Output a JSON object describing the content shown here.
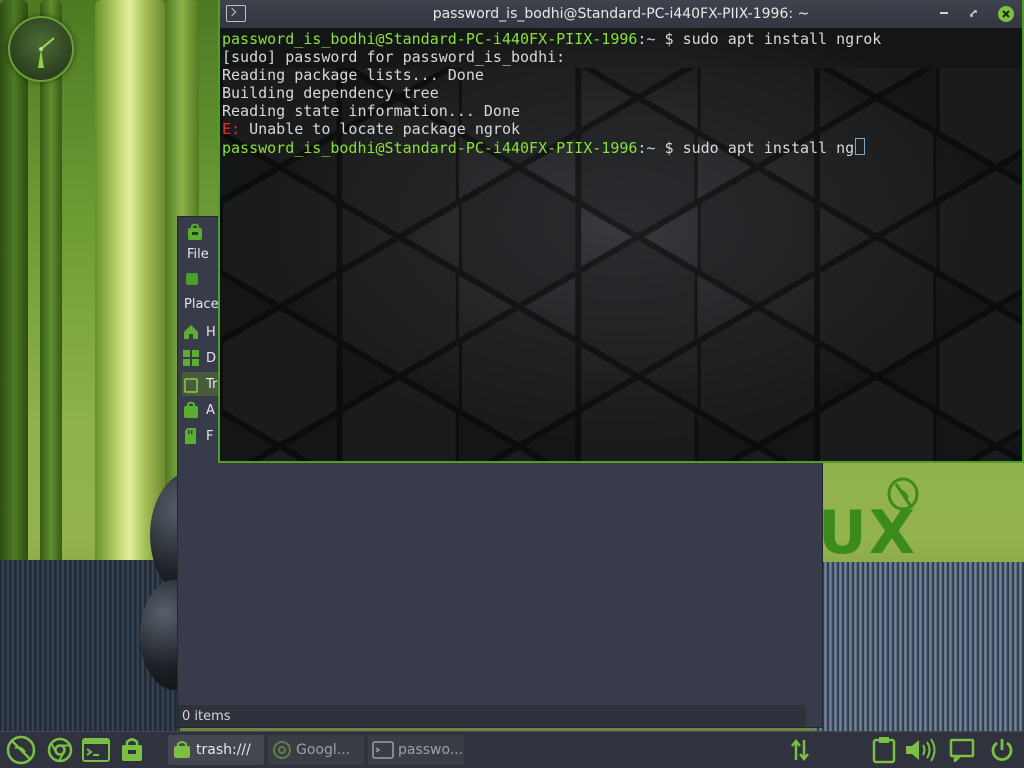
{
  "terminal": {
    "title": "password_is_bodhi@Standard-PC-i440FX-PIIX-1996: ~",
    "lines": [
      {
        "user": "password_is_bodhi@Standard-PC-i440FX-PIIX-1996",
        "path": ":~",
        "cmd": "$ sudo apt install ngrok"
      },
      {
        "text": "[sudo] password for password_is_bodhi:"
      },
      {
        "text": "Reading package lists... Done"
      },
      {
        "text": "Building dependency tree"
      },
      {
        "text": "Reading state information... Done"
      },
      {
        "errPrefix": "E:",
        "text": " Unable to locate package ngrok"
      },
      {
        "user": "password_is_bodhi@Standard-PC-i440FX-PIIX-1996",
        "path": ":~",
        "cmd": "$ sudo apt install ng"
      }
    ]
  },
  "file_manager": {
    "menu_file": "File",
    "places_label": "Place",
    "sidebar_items": [
      {
        "label": "H",
        "icon": "home-folder-icon"
      },
      {
        "label": "D",
        "icon": "desktop-grid-icon"
      },
      {
        "label": "Tr",
        "icon": "trash-icon"
      },
      {
        "label": "A",
        "icon": "applications-bag-icon"
      },
      {
        "label": "F",
        "icon": "filesystem-icon"
      }
    ],
    "status": "0 items"
  },
  "desktop": {
    "brand_text": "UX"
  },
  "taskbar": {
    "tasks": [
      {
        "label": "trash:///",
        "icon": "folder-bag-icon"
      },
      {
        "label": "Googl...",
        "icon": "chrome-icon"
      },
      {
        "label": "passwo...",
        "icon": "terminal-icon"
      }
    ]
  },
  "colors": {
    "accent": "#7bc043",
    "prompt_green": "#8ae234",
    "error_red": "#ef2929",
    "panel_bg": "#30333d"
  }
}
